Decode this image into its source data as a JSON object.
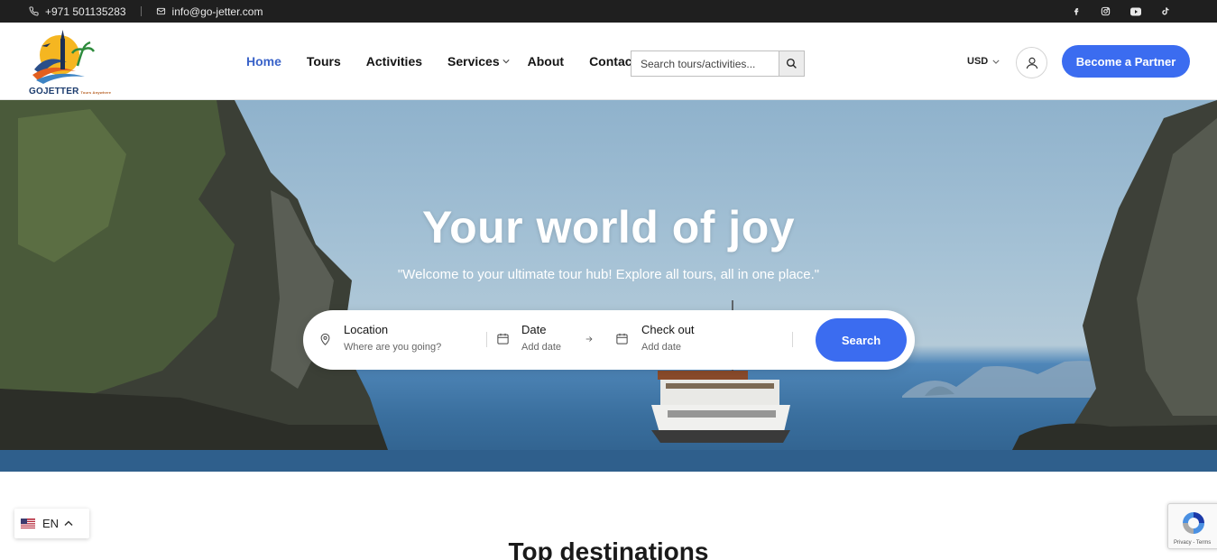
{
  "topbar": {
    "phone": "+971 501135283",
    "email": "info@go-jetter.com",
    "socials": [
      "facebook-icon",
      "instagram-icon",
      "youtube-icon",
      "tiktok-icon"
    ]
  },
  "header": {
    "logo_text": "GOJETTER",
    "logo_tag": "Tours Anywhere",
    "nav": [
      {
        "label": "Home",
        "active": true
      },
      {
        "label": "Tours"
      },
      {
        "label": "Activities"
      },
      {
        "label": "Services"
      },
      {
        "label": "About"
      },
      {
        "label": "Contact"
      }
    ],
    "search_placeholder": "Search tours/activities...",
    "currency": "USD",
    "partner_label": "Become a Partner"
  },
  "hero": {
    "title": "Your world of joy",
    "subtitle": "\"Welcome to your ultimate tour hub! Explore all tours, all in one place.\"",
    "search": {
      "location_label": "Location",
      "location_placeholder": "Where are you going?",
      "date_label": "Date",
      "date_placeholder": "Add date",
      "checkout_label": "Check out",
      "checkout_placeholder": "Add date",
      "button_label": "Search"
    }
  },
  "language": {
    "code": "EN"
  },
  "section": {
    "title": "Top destinations"
  },
  "recaptcha": {
    "text": "Privacy - Terms"
  },
  "colors": {
    "accent": "#3b6cf0",
    "nav_active": "#3a63c9",
    "topbar": "#1f1f1f"
  }
}
